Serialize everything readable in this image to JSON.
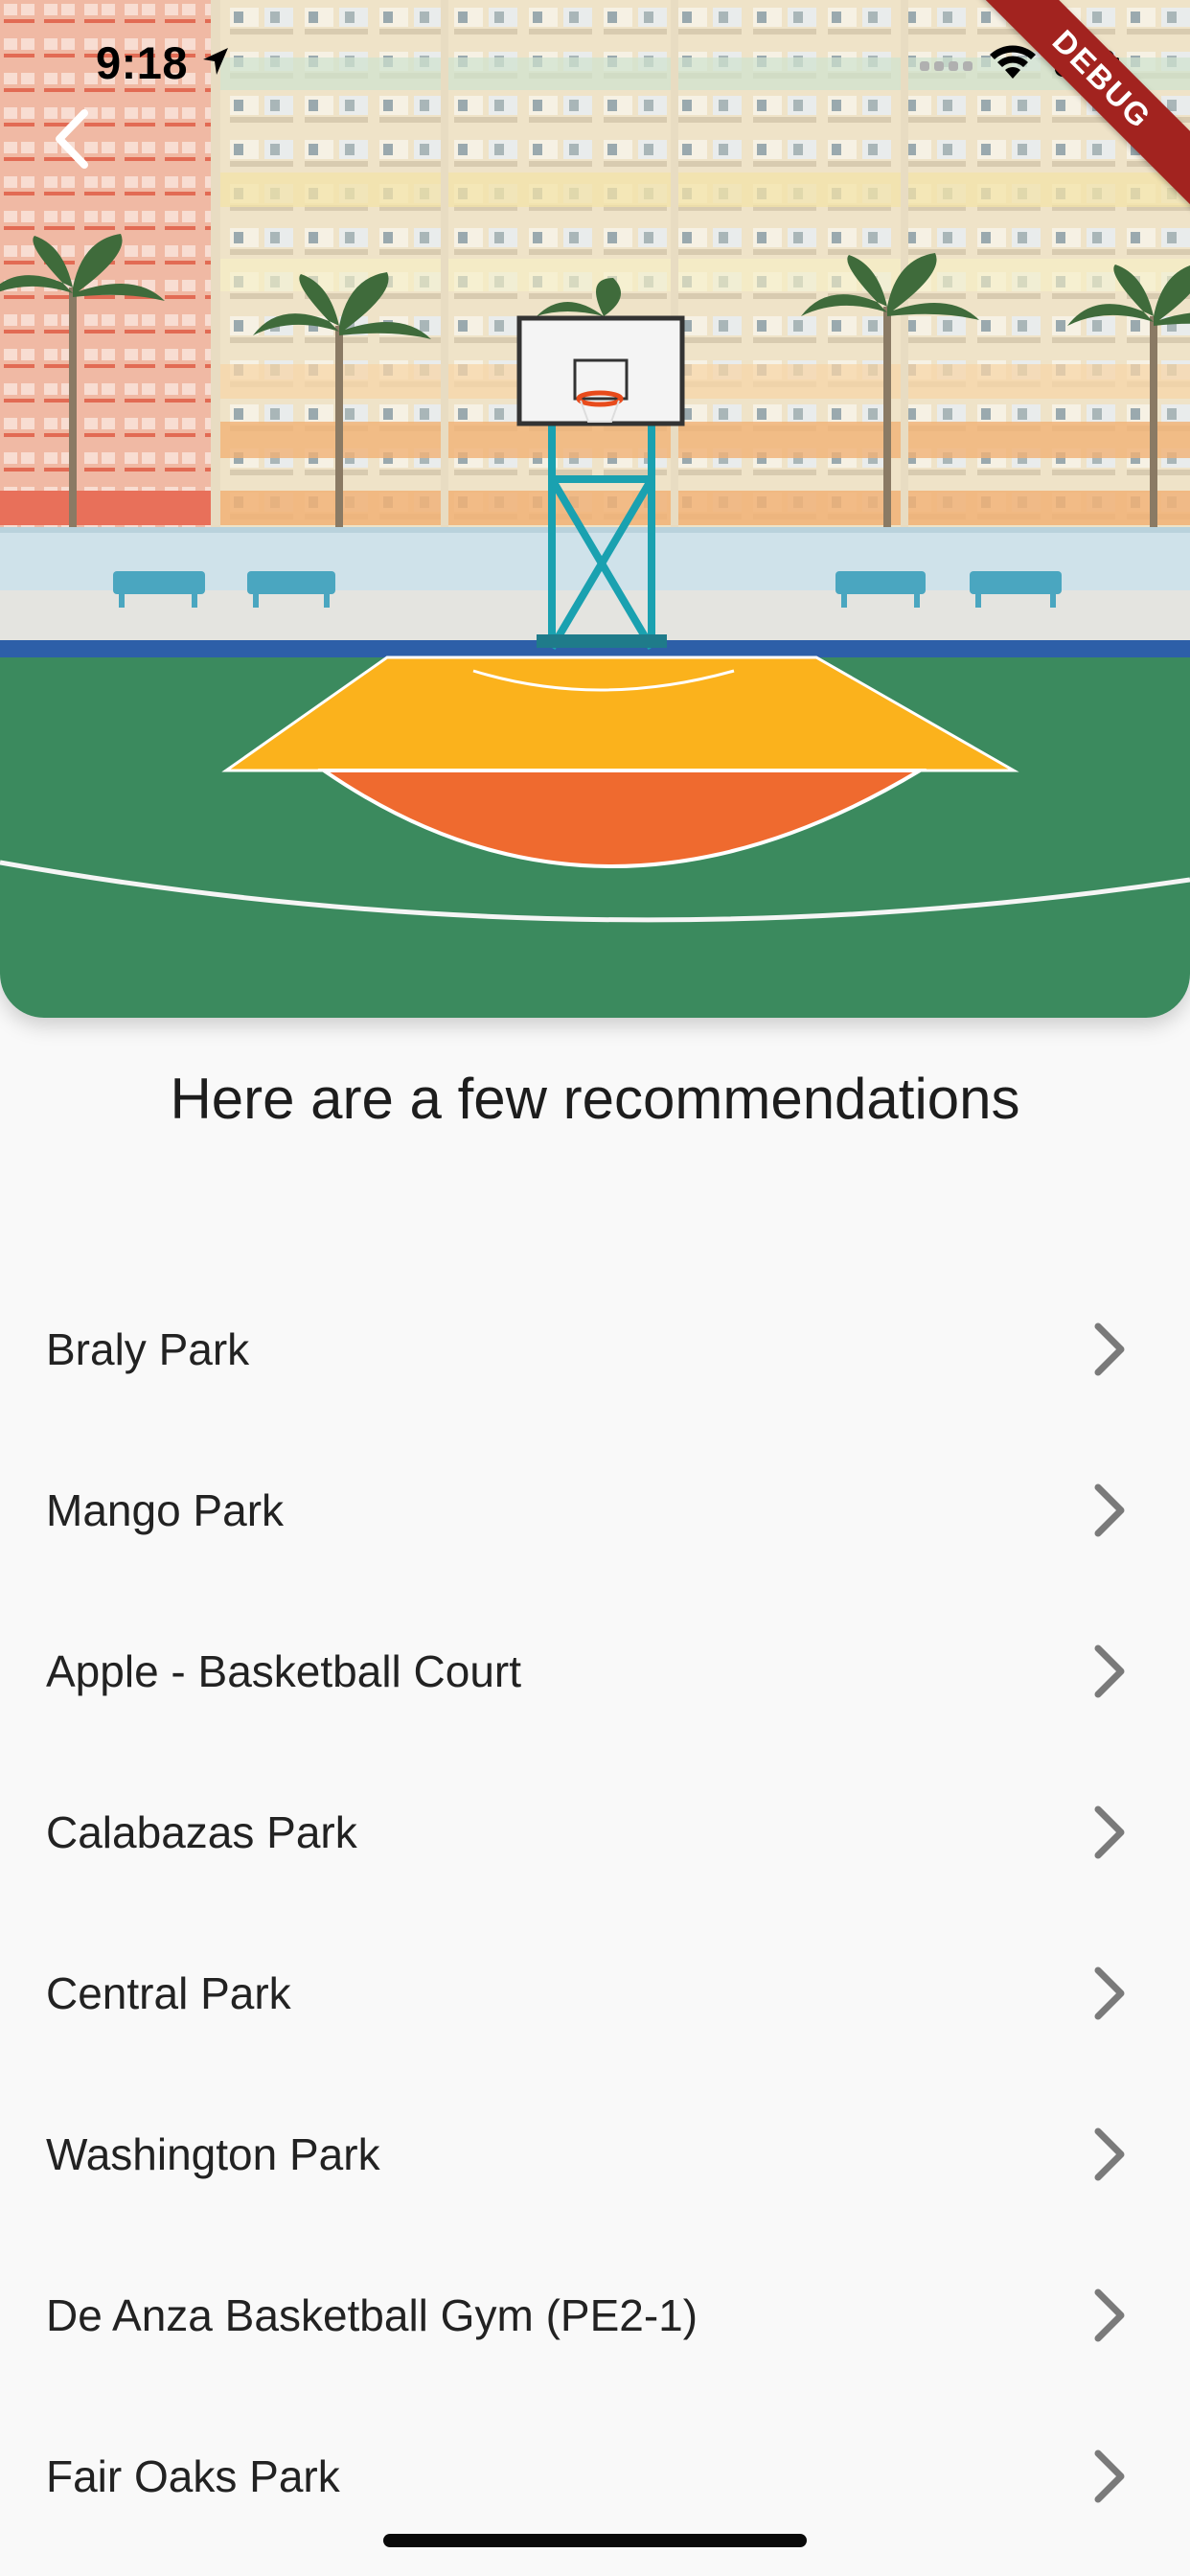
{
  "status_bar": {
    "time": "9:18",
    "icons": [
      "location-arrow-icon",
      "wifi-icon",
      "battery-icon"
    ]
  },
  "debug_banner": {
    "label": "DEBUG"
  },
  "hero": {
    "image": "basketball-court-photo",
    "back_icon": "chevron-left-icon"
  },
  "page_title": "Here are a few recommendations",
  "recommendations": [
    {
      "label": "Braly Park"
    },
    {
      "label": "Mango Park"
    },
    {
      "label": "Apple - Basketball Court"
    },
    {
      "label": "Calabazas Park"
    },
    {
      "label": "Central Park"
    },
    {
      "label": "Washington Park"
    },
    {
      "label": "De Anza Basketball Gym (PE2-1)"
    },
    {
      "label": "Fair Oaks Park"
    }
  ],
  "colors": {
    "background": "#f9f9f9",
    "text": "#222222",
    "chevron": "#7a7a7a",
    "debug_banner": "#a2231f"
  }
}
